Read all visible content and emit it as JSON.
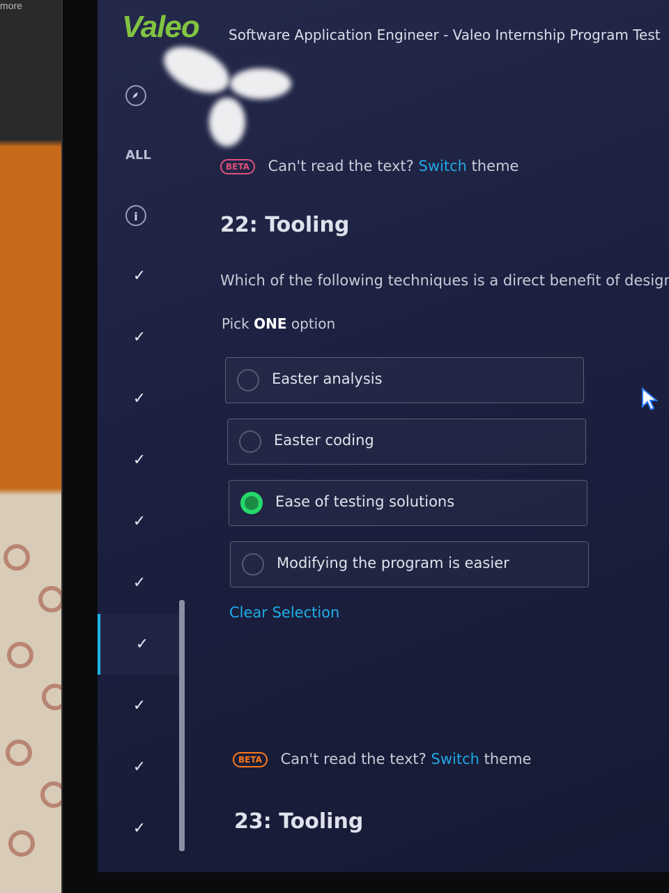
{
  "photo": {
    "corner_label": "more"
  },
  "header": {
    "logo": "Valeo",
    "title_role": "Software Application Engineer",
    "title_sep": "-",
    "title_program": "Valeo Internship Program Test"
  },
  "sidebar": {
    "all_label": "ALL",
    "nav_icon": "compass-icon",
    "info_icon": "info-icon",
    "info_glyph": "i",
    "check_glyph": "✓",
    "items": [
      {
        "state": "answered",
        "active": false
      },
      {
        "state": "answered",
        "active": false
      },
      {
        "state": "answered",
        "active": false
      },
      {
        "state": "answered",
        "active": false
      },
      {
        "state": "answered",
        "active": false
      },
      {
        "state": "answered",
        "active": false
      },
      {
        "state": "answered",
        "active": true
      },
      {
        "state": "answered",
        "active": false
      },
      {
        "state": "answered",
        "active": false
      },
      {
        "state": "answered",
        "active": false
      }
    ]
  },
  "theme_notice": {
    "beta": "BETA",
    "prefix": "Can't read the text?",
    "link": "Switch",
    "suffix": "theme"
  },
  "question22": {
    "title": "22: Tooling",
    "text": "Which of the following techniques is a direct benefit of design pat",
    "pick_prefix": "Pick",
    "pick_emph": "ONE",
    "pick_suffix": "option",
    "options": [
      {
        "label": "Easter analysis",
        "selected": false
      },
      {
        "label": "Easter coding",
        "selected": false
      },
      {
        "label": "Ease of testing solutions",
        "selected": true
      },
      {
        "label": "Modifying the program is easier",
        "selected": false
      }
    ],
    "clear_label": "Clear Selection"
  },
  "question23": {
    "title": "23: Tooling"
  },
  "colors": {
    "accent": "#1eb6e6",
    "selected_radio": "#26d96a",
    "logo": "#82c341",
    "beta_pink": "#e0507a",
    "beta_orange": "#ff7a1a"
  }
}
